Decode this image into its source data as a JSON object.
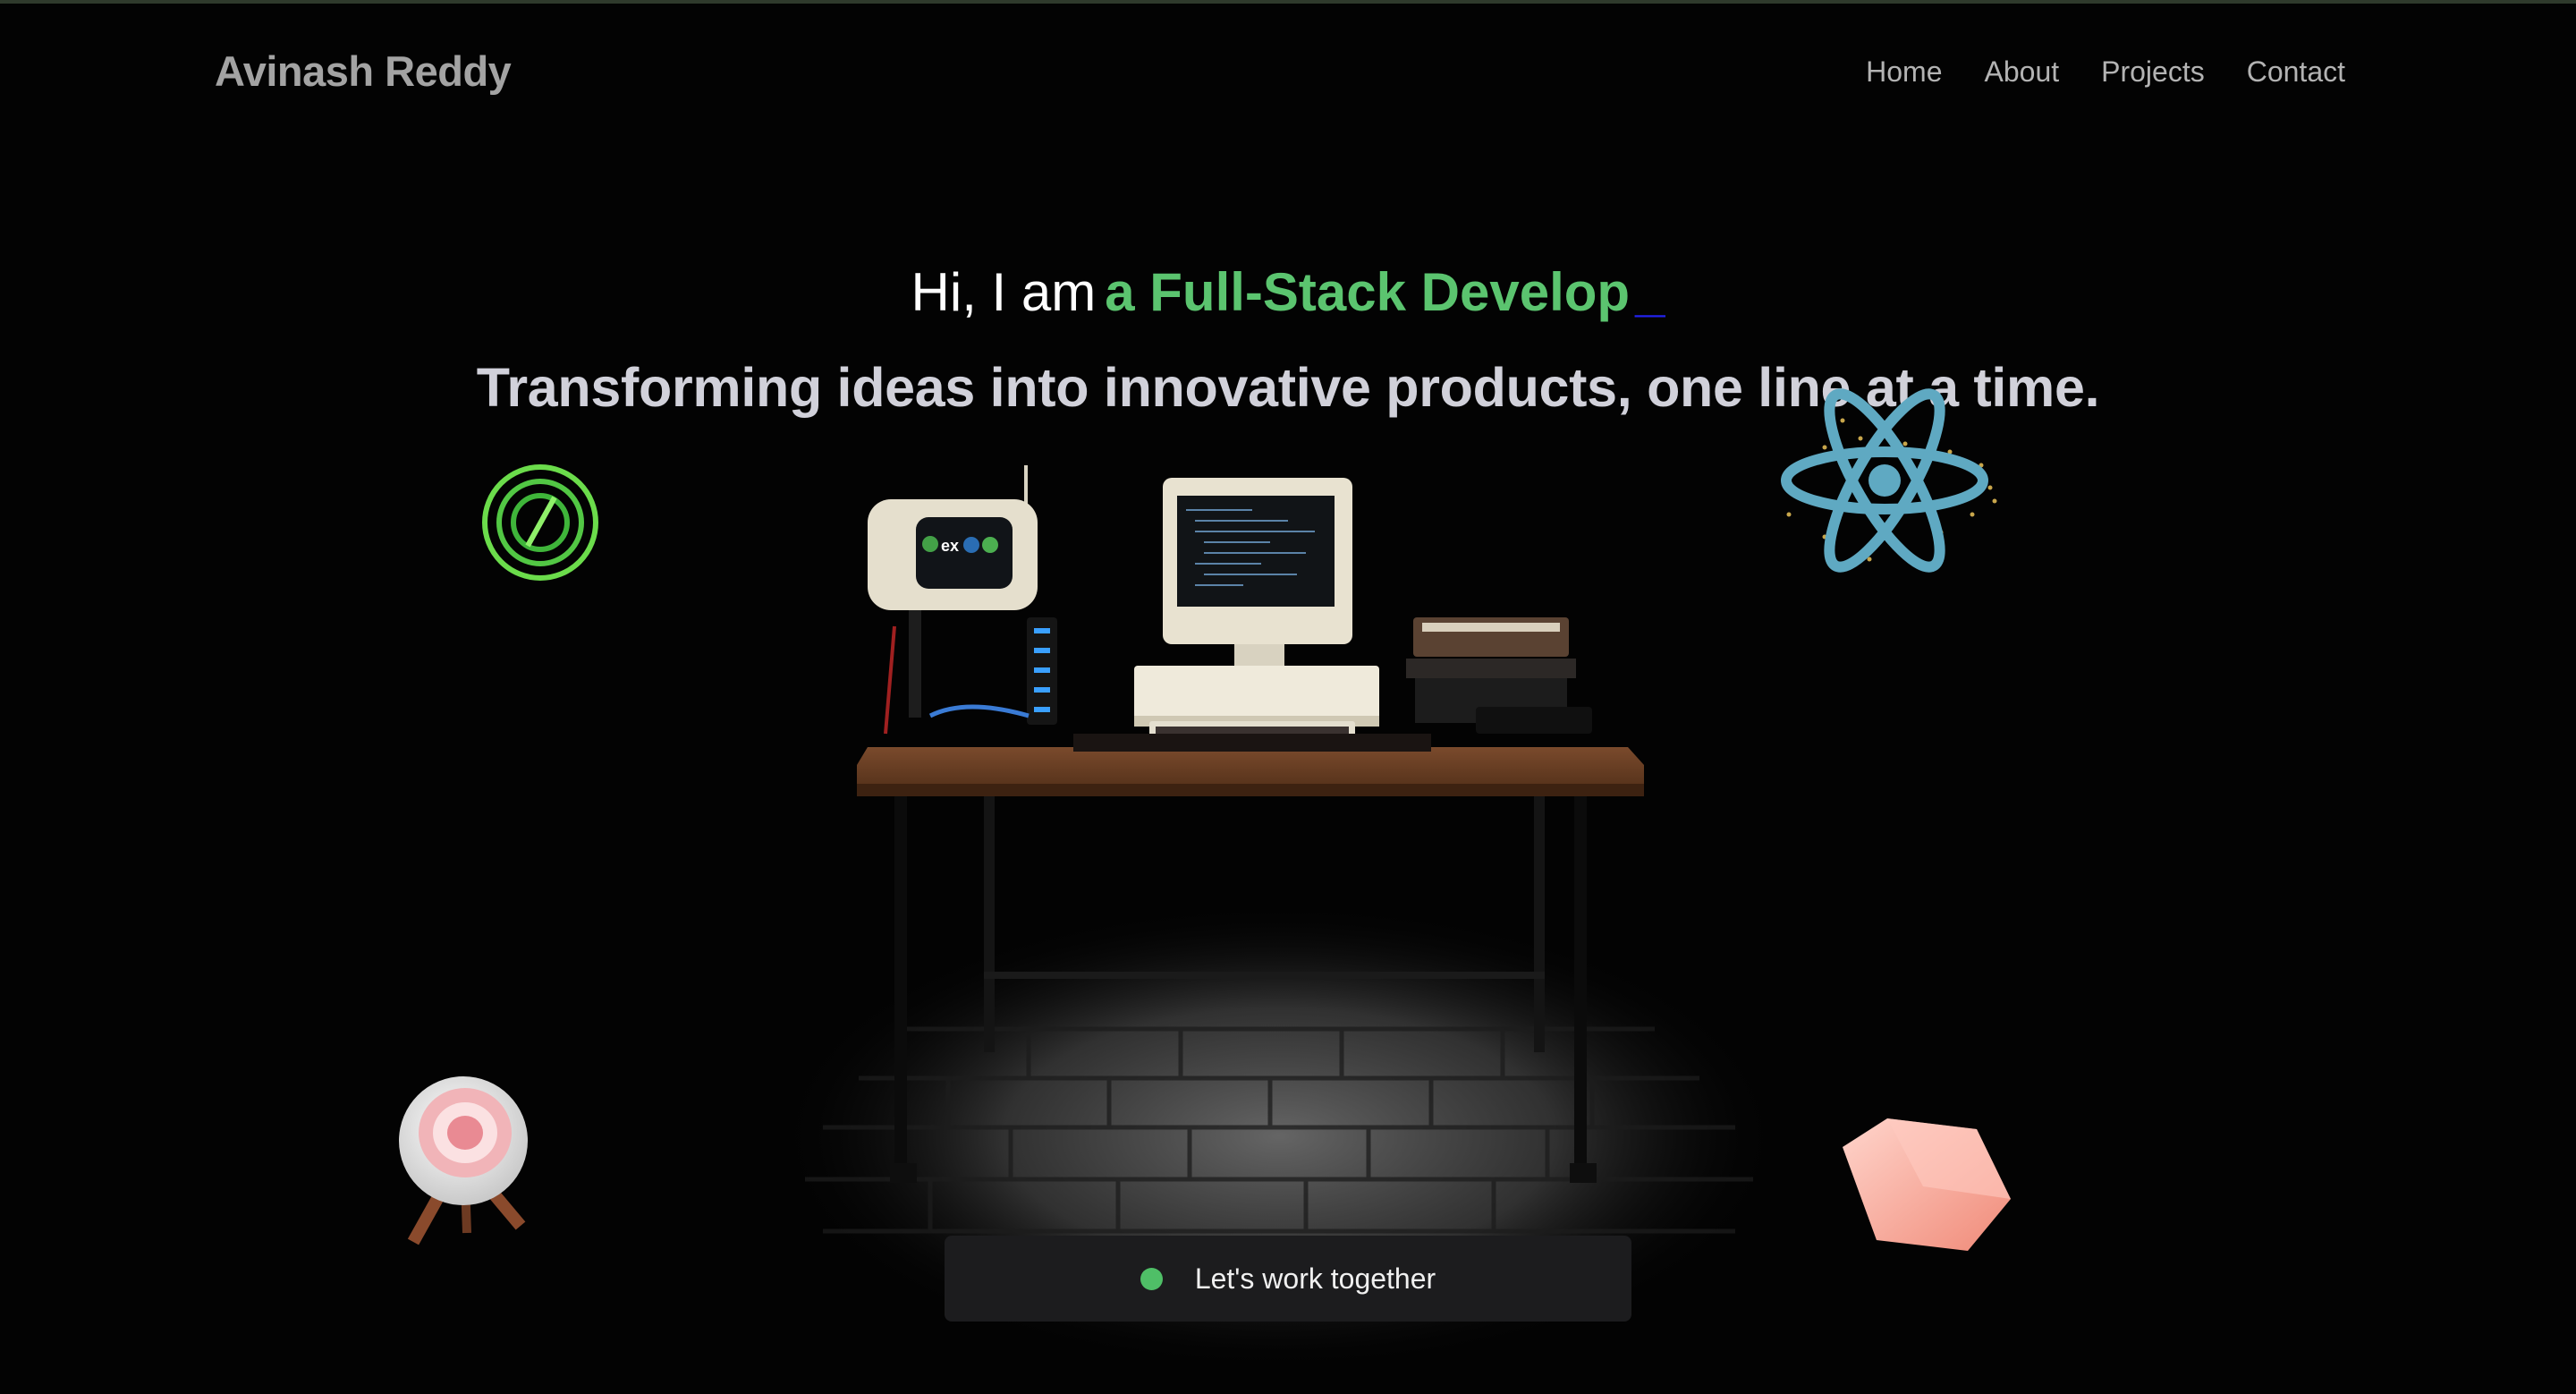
{
  "header": {
    "brand": "Avinash Reddy",
    "nav": [
      "Home",
      "About",
      "Projects",
      "Contact"
    ]
  },
  "hero": {
    "greeting": "Hi, I am",
    "role_typed": "a Full-Stack Develop",
    "cursor": "_",
    "tagline": "Transforming ideas into innovative products, one line at a time."
  },
  "cta": {
    "label": "Let's work together"
  },
  "scene": {
    "objects": [
      "retro-desk-3d",
      "radio-icon",
      "react-atom-icon",
      "target-icon",
      "cube-icon"
    ],
    "radio_screen_text": "ex"
  },
  "colors": {
    "background": "#030303",
    "accent_green": "#5bc46f",
    "cursor_blue": "#2222ee",
    "cta_bg": "#1c1c1e"
  }
}
